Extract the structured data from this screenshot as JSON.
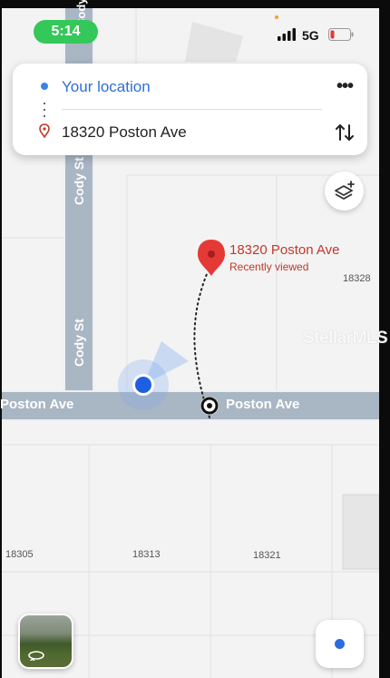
{
  "status_bar": {
    "time": "5:14",
    "network": "5G"
  },
  "directions": {
    "origin": "Your location",
    "destination": "18320 Poston Ave"
  },
  "map": {
    "pin": {
      "title": "18320 Poston Ave",
      "subtitle": "Recently viewed"
    },
    "streets": {
      "main_left": "Poston Ave",
      "main_right": "Poston Ave",
      "cross_upper": "Cody St",
      "cross_lower": "Cody St"
    },
    "parcels": [
      "18328",
      "18305",
      "18313",
      "18321"
    ],
    "watermark": "StellarMLS"
  },
  "colors": {
    "route_blue": "#2f6fd6",
    "pin_red": "#e53935",
    "street_fill": "#a9b6c3",
    "user_dot": "#1d5fe0"
  }
}
